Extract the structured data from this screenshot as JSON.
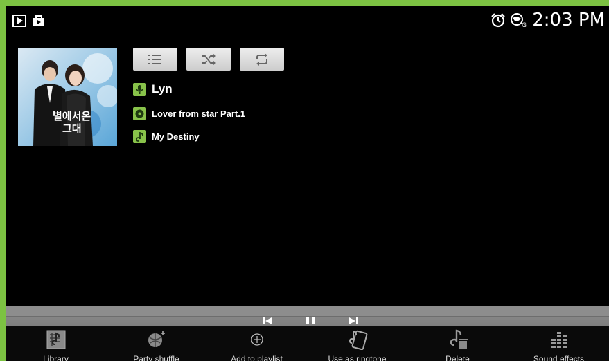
{
  "status_bar": {
    "time": "2:03 PM",
    "left_icons": [
      "play-store-icon",
      "shopping-bag-icon"
    ],
    "right_icons": [
      "alarm-clock-icon",
      "settings-globe-icon"
    ]
  },
  "controls": {
    "buttons": [
      "playlist-icon",
      "shuffle-icon",
      "repeat-icon"
    ]
  },
  "track": {
    "artist": "Lyn",
    "album": "Lover from star Part.1",
    "title": "My Destiny"
  },
  "playback": {
    "buttons": [
      "previous-icon",
      "pause-icon",
      "next-icon"
    ]
  },
  "bottom_bar": {
    "items": [
      {
        "label": "Library",
        "icon": "library-icon"
      },
      {
        "label": "Party shuffle",
        "icon": "party-shuffle-icon"
      },
      {
        "label": "Add to playlist",
        "icon": "add-icon"
      },
      {
        "label": "Use as ringtone",
        "icon": "ringtone-icon"
      },
      {
        "label": "Delete",
        "icon": "delete-icon"
      },
      {
        "label": "Sound effects",
        "icon": "equalizer-icon"
      }
    ]
  },
  "colors": {
    "frame": "#7cc242",
    "background": "#000000",
    "accent": "#88c24a"
  }
}
